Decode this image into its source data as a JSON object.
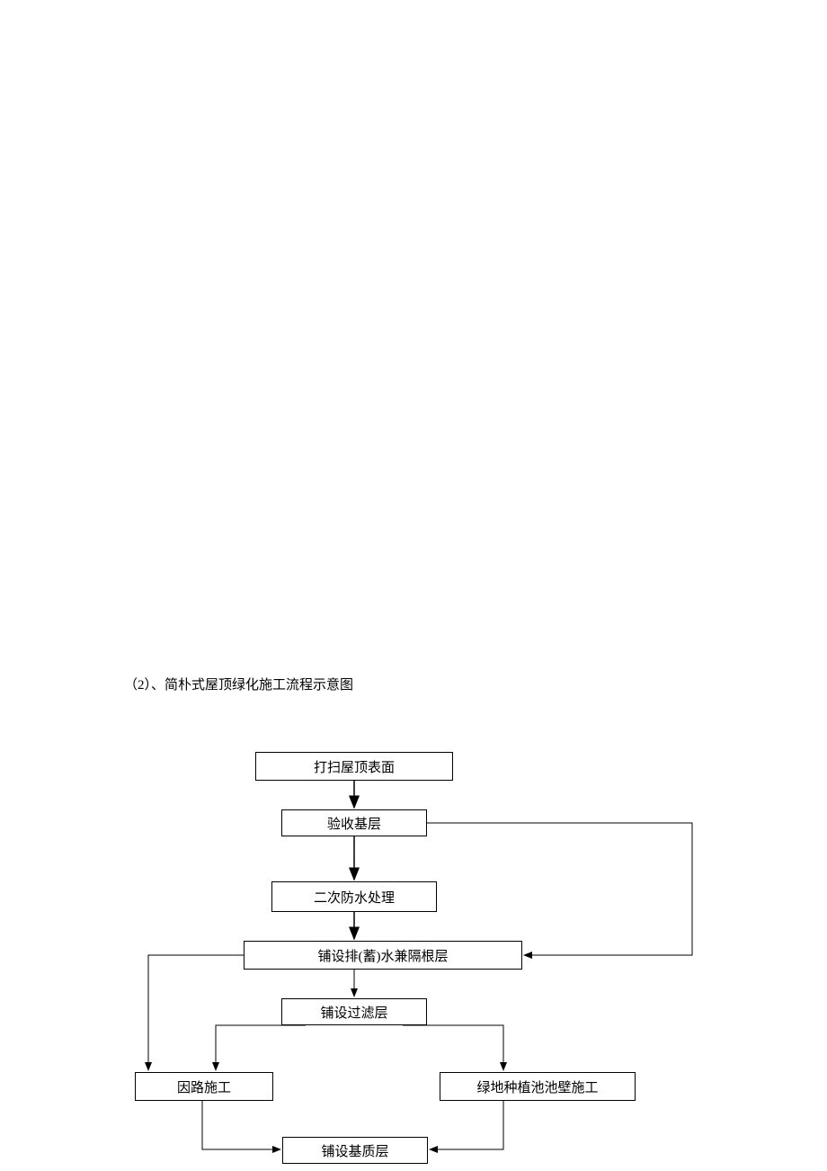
{
  "title": "（2）、简朴式屋顶绿化施工流程示意图",
  "nodes": {
    "n1": "打扫屋顶表面",
    "n2": "验收基层",
    "n3": "二次防水处理",
    "n4": "铺设排(蓄)水兼隔根层",
    "n5": "铺设过滤层",
    "n6": "因路施工",
    "n7": "绿地种植池池壁施工",
    "n8": "铺设基质层"
  },
  "chart_data": {
    "type": "flowchart",
    "title": "简朴式屋顶绿化施工流程示意图",
    "nodes": [
      {
        "id": "n1",
        "label": "打扫屋顶表面"
      },
      {
        "id": "n2",
        "label": "验收基层"
      },
      {
        "id": "n3",
        "label": "二次防水处理"
      },
      {
        "id": "n4",
        "label": "铺设排(蓄)水兼隔根层"
      },
      {
        "id": "n5",
        "label": "铺设过滤层"
      },
      {
        "id": "n6",
        "label": "因路施工"
      },
      {
        "id": "n7",
        "label": "绿地种植池池壁施工"
      },
      {
        "id": "n8",
        "label": "铺设基质层"
      }
    ],
    "edges": [
      {
        "from": "n1",
        "to": "n2"
      },
      {
        "from": "n2",
        "to": "n3"
      },
      {
        "from": "n2",
        "to": "n4"
      },
      {
        "from": "n3",
        "to": "n4"
      },
      {
        "from": "n4",
        "to": "n5"
      },
      {
        "from": "n4",
        "to": "n6"
      },
      {
        "from": "n5",
        "to": "n7"
      },
      {
        "from": "n5",
        "to": "n6"
      },
      {
        "from": "n6",
        "to": "n8"
      },
      {
        "from": "n7",
        "to": "n8"
      }
    ]
  }
}
